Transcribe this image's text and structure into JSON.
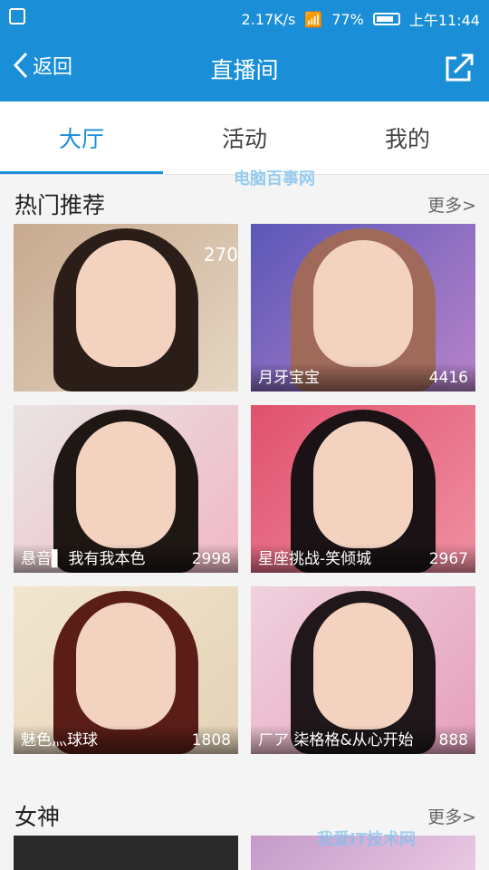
{
  "status": {
    "speed": "2.17K/s",
    "battery_pct": "77%",
    "time": "上午11:44"
  },
  "navbar": {
    "back_label": "返回",
    "title": "直播间"
  },
  "tabs": [
    {
      "label": "大厅"
    },
    {
      "label": "活动"
    },
    {
      "label": "我的"
    }
  ],
  "hot": {
    "title": "热门推荐",
    "more": "更多>",
    "cards": [
      {
        "name": "",
        "count": "270"
      },
      {
        "name": "月牙宝宝",
        "count": "4416"
      },
      {
        "name": "悬音▌ 我有我本色",
        "count": "2998"
      },
      {
        "name": "星座挑战-笑倾城",
        "count": "2967"
      },
      {
        "name": "魅色灬球球",
        "count": "1808"
      },
      {
        "name": "ㄏア 柒格格&从心开始",
        "count": "888"
      }
    ]
  },
  "goddess": {
    "title": "女神",
    "more": "更多>"
  },
  "watermarks": {
    "top": "电脑百事网",
    "bottom": "我爱IT技术网"
  },
  "colors": {
    "accent": "#1a8fd8"
  }
}
